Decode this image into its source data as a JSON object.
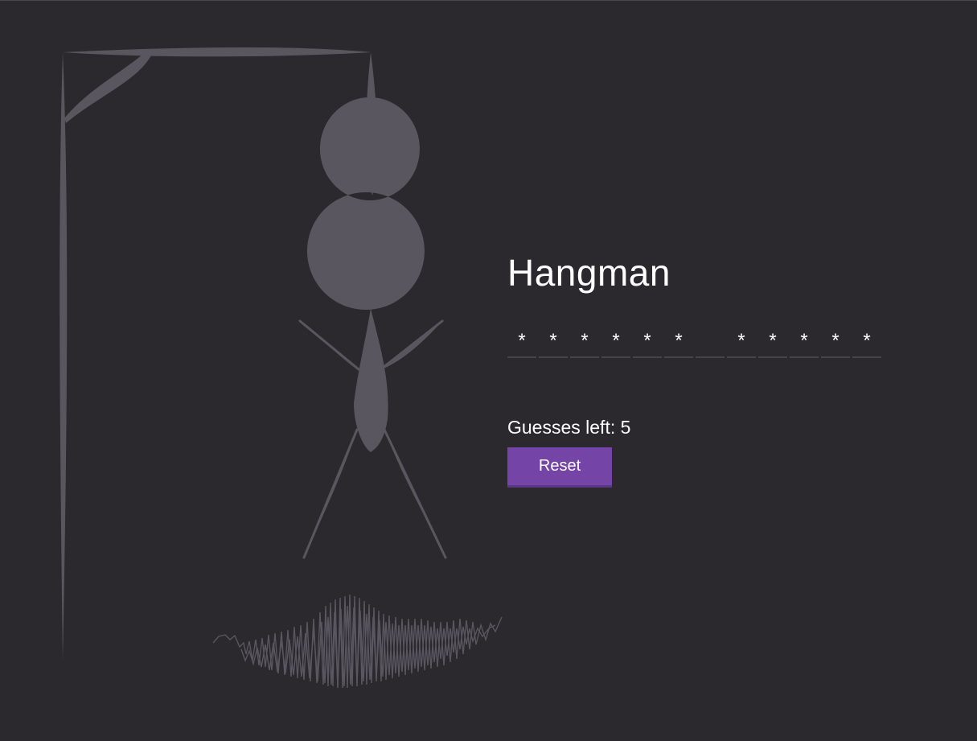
{
  "game": {
    "title": "Hangman",
    "word_slots": [
      "*",
      "*",
      "*",
      "*",
      "*",
      "*",
      "",
      "*",
      "*",
      "*",
      "*",
      "*"
    ],
    "guesses_label": "Guesses left: 5",
    "reset_label": "Reset"
  },
  "colors": {
    "background": "#2b282e",
    "drawing": "#5a5660",
    "accent": "#7445a6",
    "text": "#ffffff"
  }
}
